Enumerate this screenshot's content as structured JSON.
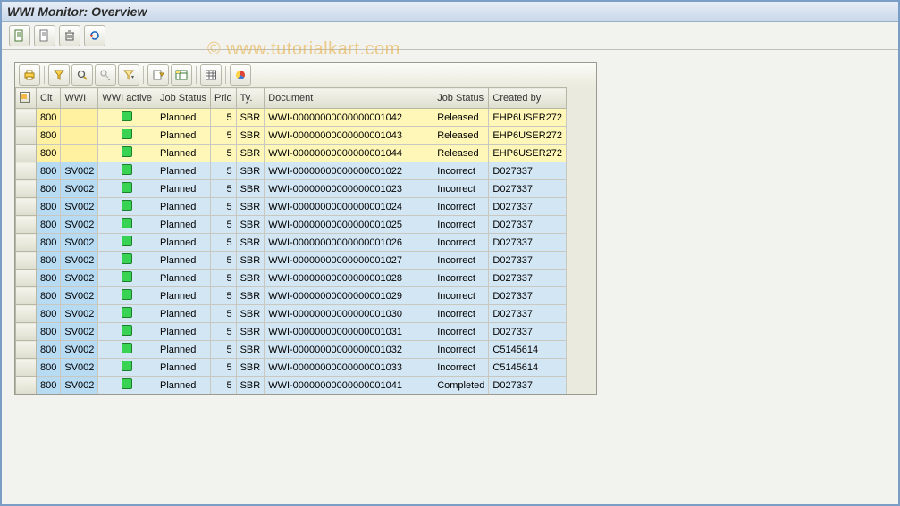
{
  "window": {
    "title": "WWI Monitor: Overview"
  },
  "watermark": "© www.tutorialkart.com",
  "appToolbar": {
    "btn1": "document-icon",
    "btn2": "display-icon",
    "btn3": "delete-icon",
    "btn4": "refresh-icon"
  },
  "alvToolbar": {
    "b1": "print-icon",
    "b2": "filter-icon",
    "b3": "find-icon",
    "b4": "find-next-icon",
    "b5": "set-filter-icon",
    "b6": "export-icon",
    "b7": "spreadsheet-icon",
    "b8": "layout-icon",
    "b9": "chart-icon"
  },
  "columns": {
    "clt": "Clt",
    "wwi": "WWI",
    "active": "WWI active",
    "jobstatus1": "Job Status",
    "prio": "Prio",
    "ty": "Ty.",
    "document": "Document",
    "jobstatus2": "Job Status",
    "createdby": "Created by"
  },
  "rows": [
    {
      "highlight": "yellow",
      "clt": "800",
      "wwi": "",
      "active": true,
      "jobstatus1": "Planned",
      "prio": "5",
      "ty": "SBR",
      "document": "WWI-00000000000000001042",
      "jobstatus2": "Released",
      "createdby": "EHP6USER272"
    },
    {
      "highlight": "yellow",
      "clt": "800",
      "wwi": "",
      "active": true,
      "jobstatus1": "Planned",
      "prio": "5",
      "ty": "SBR",
      "document": "WWI-00000000000000001043",
      "jobstatus2": "Released",
      "createdby": "EHP6USER272"
    },
    {
      "highlight": "yellow",
      "clt": "800",
      "wwi": "",
      "active": true,
      "jobstatus1": "Planned",
      "prio": "5",
      "ty": "SBR",
      "document": "WWI-00000000000000001044",
      "jobstatus2": "Released",
      "createdby": "EHP6USER272"
    },
    {
      "highlight": "blue",
      "clt": "800",
      "wwi": "SV002",
      "active": true,
      "jobstatus1": "Planned",
      "prio": "5",
      "ty": "SBR",
      "document": "WWI-00000000000000001022",
      "jobstatus2": "Incorrect",
      "createdby": "D027337"
    },
    {
      "highlight": "blue",
      "clt": "800",
      "wwi": "SV002",
      "active": true,
      "jobstatus1": "Planned",
      "prio": "5",
      "ty": "SBR",
      "document": "WWI-00000000000000001023",
      "jobstatus2": "Incorrect",
      "createdby": "D027337"
    },
    {
      "highlight": "blue",
      "clt": "800",
      "wwi": "SV002",
      "active": true,
      "jobstatus1": "Planned",
      "prio": "5",
      "ty": "SBR",
      "document": "WWI-00000000000000001024",
      "jobstatus2": "Incorrect",
      "createdby": "D027337"
    },
    {
      "highlight": "blue",
      "clt": "800",
      "wwi": "SV002",
      "active": true,
      "jobstatus1": "Planned",
      "prio": "5",
      "ty": "SBR",
      "document": "WWI-00000000000000001025",
      "jobstatus2": "Incorrect",
      "createdby": "D027337"
    },
    {
      "highlight": "blue",
      "clt": "800",
      "wwi": "SV002",
      "active": true,
      "jobstatus1": "Planned",
      "prio": "5",
      "ty": "SBR",
      "document": "WWI-00000000000000001026",
      "jobstatus2": "Incorrect",
      "createdby": "D027337"
    },
    {
      "highlight": "blue",
      "clt": "800",
      "wwi": "SV002",
      "active": true,
      "jobstatus1": "Planned",
      "prio": "5",
      "ty": "SBR",
      "document": "WWI-00000000000000001027",
      "jobstatus2": "Incorrect",
      "createdby": "D027337"
    },
    {
      "highlight": "blue",
      "clt": "800",
      "wwi": "SV002",
      "active": true,
      "jobstatus1": "Planned",
      "prio": "5",
      "ty": "SBR",
      "document": "WWI-00000000000000001028",
      "jobstatus2": "Incorrect",
      "createdby": "D027337"
    },
    {
      "highlight": "blue",
      "clt": "800",
      "wwi": "SV002",
      "active": true,
      "jobstatus1": "Planned",
      "prio": "5",
      "ty": "SBR",
      "document": "WWI-00000000000000001029",
      "jobstatus2": "Incorrect",
      "createdby": "D027337"
    },
    {
      "highlight": "blue",
      "clt": "800",
      "wwi": "SV002",
      "active": true,
      "jobstatus1": "Planned",
      "prio": "5",
      "ty": "SBR",
      "document": "WWI-00000000000000001030",
      "jobstatus2": "Incorrect",
      "createdby": "D027337"
    },
    {
      "highlight": "blue",
      "clt": "800",
      "wwi": "SV002",
      "active": true,
      "jobstatus1": "Planned",
      "prio": "5",
      "ty": "SBR",
      "document": "WWI-00000000000000001031",
      "jobstatus2": "Incorrect",
      "createdby": "D027337"
    },
    {
      "highlight": "blue",
      "clt": "800",
      "wwi": "SV002",
      "active": true,
      "jobstatus1": "Planned",
      "prio": "5",
      "ty": "SBR",
      "document": "WWI-00000000000000001032",
      "jobstatus2": "Incorrect",
      "createdby": "C5145614"
    },
    {
      "highlight": "blue",
      "clt": "800",
      "wwi": "SV002",
      "active": true,
      "jobstatus1": "Planned",
      "prio": "5",
      "ty": "SBR",
      "document": "WWI-00000000000000001033",
      "jobstatus2": "Incorrect",
      "createdby": "C5145614"
    },
    {
      "highlight": "blue",
      "clt": "800",
      "wwi": "SV002",
      "active": true,
      "jobstatus1": "Planned",
      "prio": "5",
      "ty": "SBR",
      "document": "WWI-00000000000000001041",
      "jobstatus2": "Completed",
      "createdby": "D027337"
    }
  ]
}
